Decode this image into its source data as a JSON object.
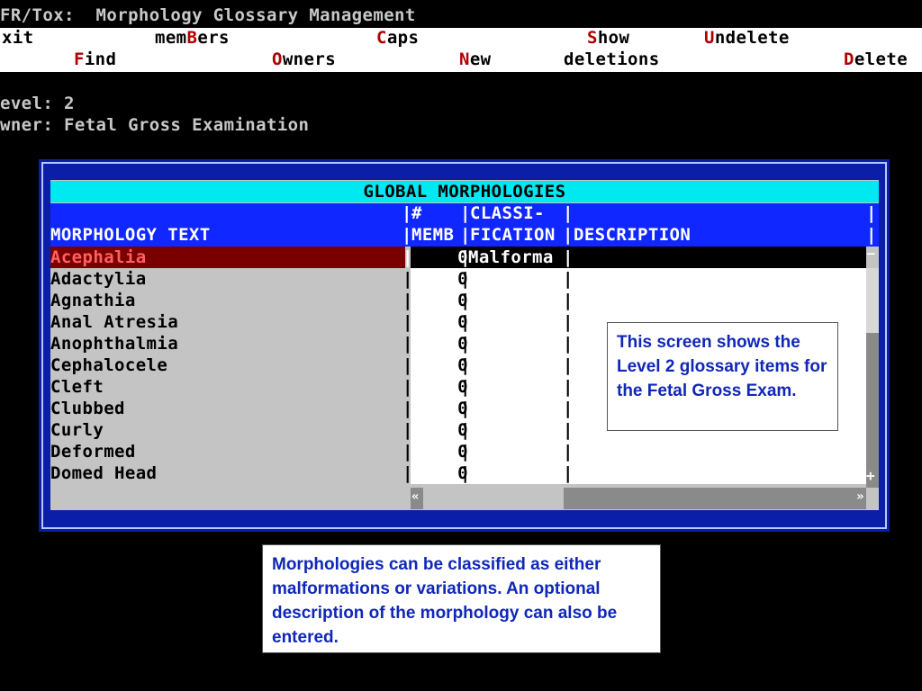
{
  "app": {
    "title": "FR/Tox:  Morphology Glossary Management"
  },
  "menu": {
    "items": [
      {
        "pre": "",
        "key": "",
        "post": "xit",
        "name": "menu-exit"
      },
      {
        "pre": "mem",
        "key": "B",
        "post": "ers",
        "name": "menu-members"
      },
      {
        "pre": "",
        "key": "C",
        "post": "aps",
        "name": "menu-caps"
      },
      {
        "pre": "",
        "key": "S",
        "post": "how",
        "name": "menu-show"
      },
      {
        "pre": "",
        "key": "U",
        "post": "ndelete",
        "name": "menu-undelete"
      },
      {
        "pre": "",
        "key": "F",
        "post": "ind",
        "name": "menu-find"
      },
      {
        "pre": "",
        "key": "O",
        "post": "wners",
        "name": "menu-owners"
      },
      {
        "pre": "",
        "key": "N",
        "post": "ew",
        "name": "menu-new"
      },
      {
        "pre": "",
        "key": "",
        "post": "deletions",
        "name": "menu-deletions"
      },
      {
        "pre": "",
        "key": "D",
        "post": "elete",
        "name": "menu-delete"
      }
    ]
  },
  "info": {
    "level_label": "evel: 2",
    "owner_label": "wner: Fetal Gross Examination"
  },
  "grid": {
    "title": "GLOBAL MORPHOLOGIES",
    "headers": {
      "text": "MORPHOLOGY TEXT",
      "memb_top": "#",
      "memb_bottom": "MEMB",
      "class_top": "CLASSI-",
      "class_bottom": "FICATION",
      "desc": "DESCRIPTION"
    },
    "rows": [
      {
        "text": "Acephalia",
        "memb": "0",
        "class": "Malforma",
        "desc": "",
        "selected": true
      },
      {
        "text": "Adactylia",
        "memb": "0",
        "class": "",
        "desc": ""
      },
      {
        "text": "Agnathia",
        "memb": "0",
        "class": "",
        "desc": ""
      },
      {
        "text": "Anal Atresia",
        "memb": "0",
        "class": "",
        "desc": ""
      },
      {
        "text": "Anophthalmia",
        "memb": "0",
        "class": "",
        "desc": ""
      },
      {
        "text": "Cephalocele",
        "memb": "0",
        "class": "",
        "desc": ""
      },
      {
        "text": "Cleft",
        "memb": "0",
        "class": "",
        "desc": ""
      },
      {
        "text": "Clubbed",
        "memb": "0",
        "class": "",
        "desc": ""
      },
      {
        "text": "Curly",
        "memb": "0",
        "class": "",
        "desc": ""
      },
      {
        "text": "Deformed",
        "memb": "0",
        "class": "",
        "desc": ""
      },
      {
        "text": "Domed Head",
        "memb": "0",
        "class": "",
        "desc": ""
      }
    ],
    "scroll": {
      "left_arrow": "«",
      "right_arrow": "»",
      "up_marker": "–",
      "down_marker": "+"
    }
  },
  "callouts": {
    "c1": "This screen shows the Level 2 glossary items for the Fetal Gross Exam.",
    "c2": "Morphologies can be classified as either malformations or variations.  An optional description of the morphology can also be entered."
  }
}
